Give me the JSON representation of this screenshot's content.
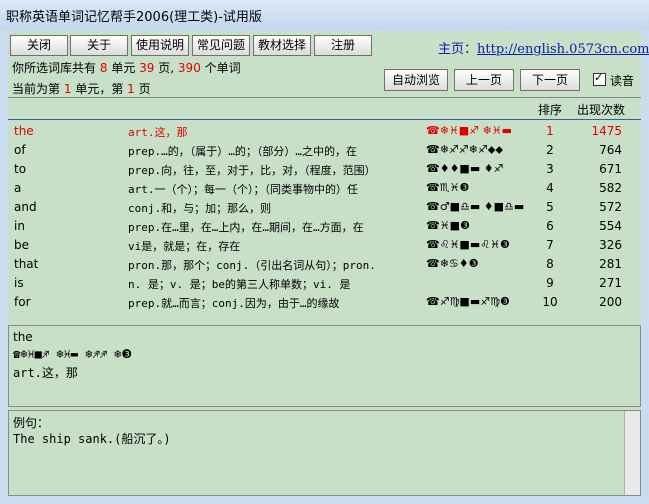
{
  "app": {
    "title": "职称英语单词记忆帮手2006(理工类)-试用版"
  },
  "toolbar": {
    "close": "关闭",
    "about": "关于",
    "help": "使用说明",
    "faq": "常见问题",
    "textbook": "教材选择",
    "register": "注册",
    "homepage_label": "主页：",
    "homepage_url": "http://english.0573cn.com/",
    "auto_browse": "自动浏览",
    "prev_page": "上一页",
    "next_page": "下一页",
    "read_aloud": "读音"
  },
  "stats": {
    "line1_a": "你所选词库共有",
    "units": "8",
    "line1_b": "单元",
    "pages": "39",
    "line1_c": "页,",
    "words": "390",
    "line1_d": "个单词",
    "line2_a": "当前为第",
    "cur_unit": "1",
    "line2_b": "单元，第",
    "cur_page": "1",
    "line2_c": "页"
  },
  "list": {
    "col_rank": "排序",
    "col_count": "出现次数",
    "rows": [
      {
        "word": "the",
        "def": "art.这，那",
        "pho": "☎❄♓■♐  ❄♓▬",
        "rank": "1",
        "count": "1475"
      },
      {
        "word": "of",
        "def": "prep.…的，（属于）…的；（部分）…之中的，在",
        "pho": "☎❄♐♐❄♐⬥⬥",
        "rank": "2",
        "count": "764"
      },
      {
        "word": "to",
        "def": "prep.向，往，至，对于，比，对，（程度，范围）",
        "pho": "☎♦♦■▬  ♦♐",
        "rank": "3",
        "count": "671"
      },
      {
        "word": "a",
        "def": "art.一（个）；每一（个）；（同类事物中的）任",
        "pho": "☎♏♓❸",
        "rank": "4",
        "count": "582"
      },
      {
        "word": "and",
        "def": "conj.和，与；加；那么，则",
        "pho": "☎♂■♎▬  ♦■♎▬",
        "rank": "5",
        "count": "572"
      },
      {
        "word": "in",
        "def": "prep.在…里，在…上内，在…期间，在…方面，在",
        "pho": "☎♓■❸",
        "rank": "6",
        "count": "554"
      },
      {
        "word": "be",
        "def": "vi是，就是；在，存在",
        "pho": "☎♌♓■▬♌♓❸",
        "rank": "7",
        "count": "326"
      },
      {
        "word": "that",
        "def": "pron.那，那个；conj.（引出名词从句）；pron.",
        "pho": "☎❄♋♦❸",
        "rank": "8",
        "count": "281"
      },
      {
        "word": "is",
        "def": "n. 是；v. 是；be的第三人称单数；vi. 是",
        "pho": "",
        "rank": "9",
        "count": "271"
      },
      {
        "word": "for",
        "def": "prep.就…而言；conj.因为，由于…的缘故",
        "pho": "☎♐♍■▬♐♍❸",
        "rank": "10",
        "count": "200"
      }
    ]
  },
  "detail": {
    "word": "the",
    "phonetic": "☎❄♓■♐  ❄♓▬  ❄♐♐  ❄❸",
    "meaning": "art.这，那"
  },
  "example": {
    "label": "例句：",
    "sentence": "The ship sank.(船沉了。)"
  },
  "colors": {
    "highlight": "#e00000",
    "background": "#c8dfc8",
    "link": "#0a1fa8"
  }
}
